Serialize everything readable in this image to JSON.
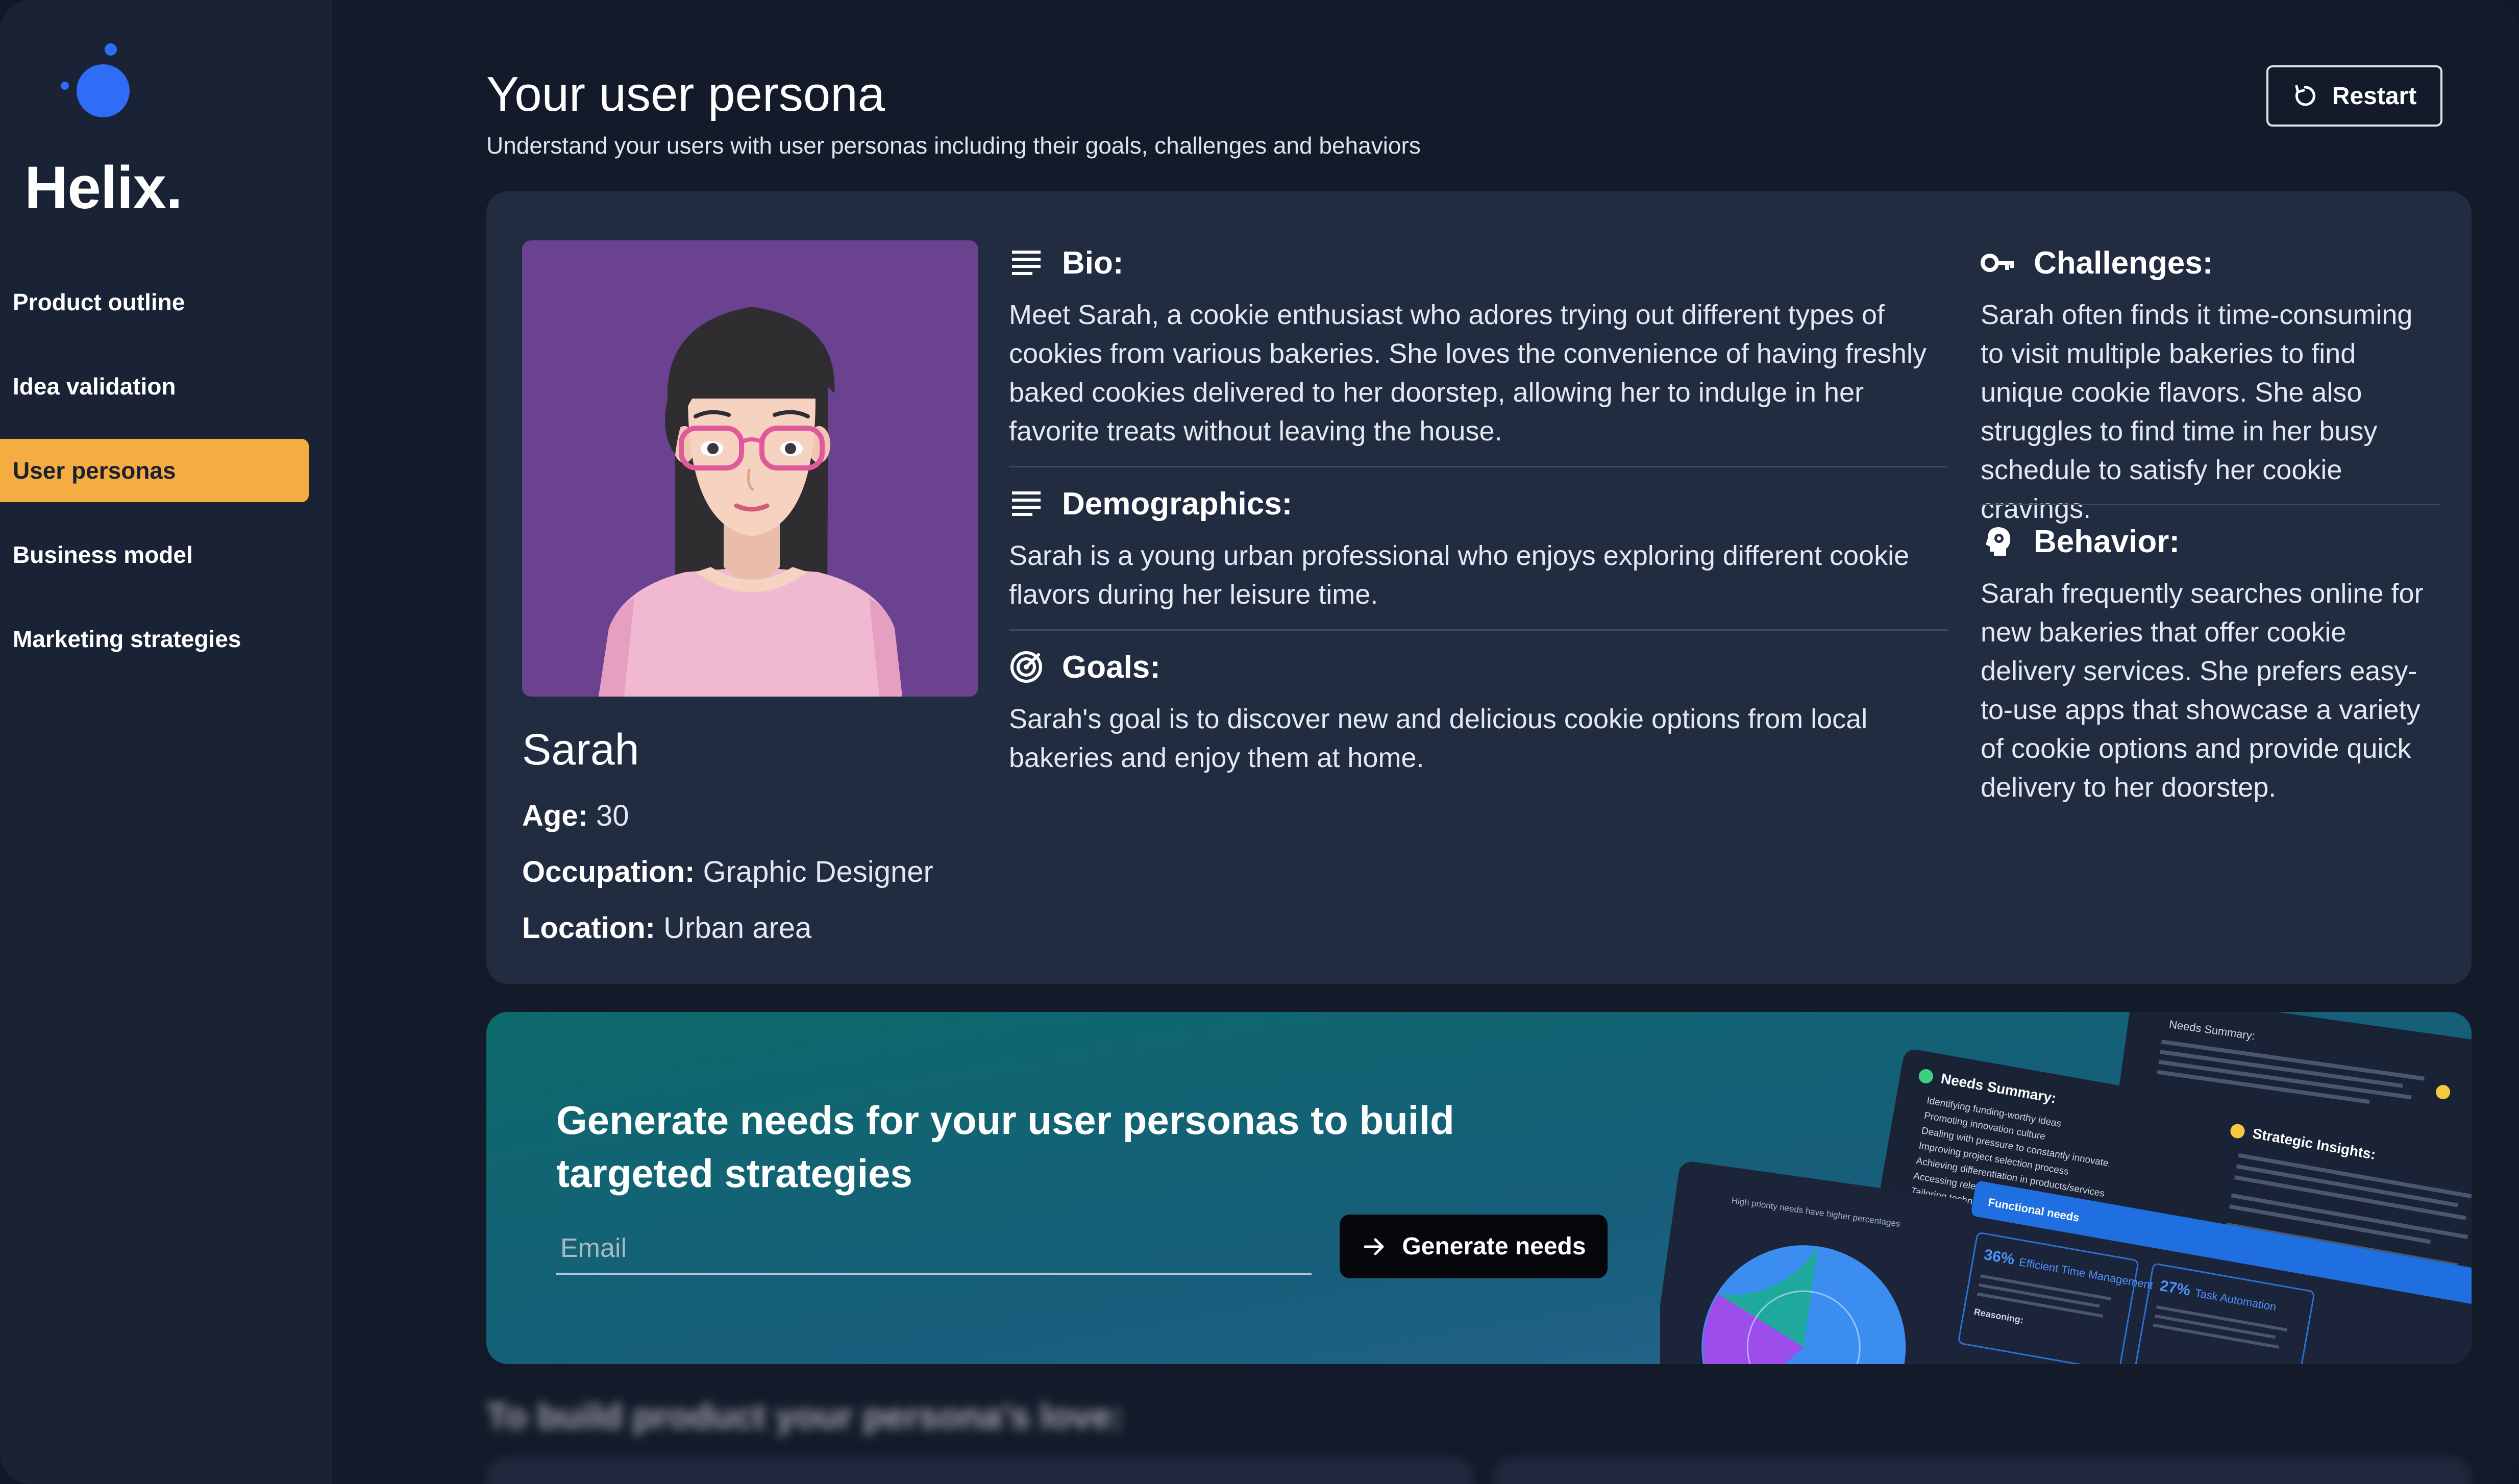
{
  "app": {
    "brand": "Helix."
  },
  "sidebar": {
    "items": [
      {
        "label": "Product outline",
        "active": false
      },
      {
        "label": "Idea validation",
        "active": false
      },
      {
        "label": "User personas",
        "active": true
      },
      {
        "label": "Business model",
        "active": false
      },
      {
        "label": "Marketing strategies",
        "active": false
      }
    ]
  },
  "header": {
    "title": "Your user persona",
    "subtitle": "Understand your users with user personas including their goals, challenges and behaviors",
    "restart_label": "Restart"
  },
  "persona": {
    "name": "Sarah",
    "fields": [
      {
        "key": "Age:",
        "value": "30"
      },
      {
        "key": "Occupation:",
        "value": "Graphic Designer"
      },
      {
        "key": "Location:",
        "value": "Urban area"
      }
    ],
    "bio": {
      "title": "Bio:",
      "text": "Meet Sarah, a cookie enthusiast who adores trying out different types of cookies from various bakeries. She loves the convenience of having freshly baked cookies delivered to her doorstep, allowing her to indulge in her favorite treats without leaving the house."
    },
    "demographics": {
      "title": "Demographics:",
      "text": "Sarah is a young urban professional who enjoys exploring different cookie flavors during her leisure time."
    },
    "goals": {
      "title": "Goals:",
      "text": "Sarah's goal is to discover new and delicious cookie options from local bakeries and enjoy them at home."
    },
    "challenges": {
      "title": "Challenges:",
      "text": "Sarah often finds it time-consuming to visit multiple bakeries to find unique cookie flavors. She also struggles to find time in her busy schedule to satisfy her cookie cravings."
    },
    "behavior": {
      "title": "Behavior:",
      "text": "Sarah frequently searches online for new bakeries that offer cookie delivery services. She prefers easy-to-use apps that showcase a variety of cookie options and provide quick delivery to her doorstep."
    }
  },
  "cta": {
    "title": "Generate needs for your user personas to build targeted strategies",
    "email_placeholder": "Email",
    "email_value": "",
    "button_label": "Generate needs",
    "preview": {
      "needs_summary": "Needs Summary:",
      "strategic_insights": "Strategic Insights:",
      "functional_needs": "Functional needs",
      "chart_caption": "High priority needs have higher percentages",
      "card1_pct": "36%",
      "card1_title": "Efficient Time Management",
      "card2_pct": "27%",
      "card2_title": "Task Automation",
      "reasoning": "Reasoning:",
      "items": [
        "Identifying funding-worthy ideas",
        "Promoting innovation culture",
        "Dealing with pressure to constantly innovate",
        "Improving project selection process",
        "Achieving differentiation in products/services",
        "Accessing relevant educational content",
        "Tailoring technology integration"
      ]
    }
  },
  "teaser": {
    "title": "To build product your persona's love:"
  },
  "colors": {
    "accent": "#f5ad42",
    "brand_blue": "#2f6df6",
    "avatar_bg": "#6a4290",
    "card_bg": "#222c41"
  },
  "icons": {
    "restart": "refresh-icon",
    "bio": "text-lines-icon",
    "demographics": "text-lines-icon",
    "goals": "target-icon",
    "challenges": "key-icon",
    "behavior": "head-gear-icon",
    "generate": "arrow-right-icon"
  }
}
